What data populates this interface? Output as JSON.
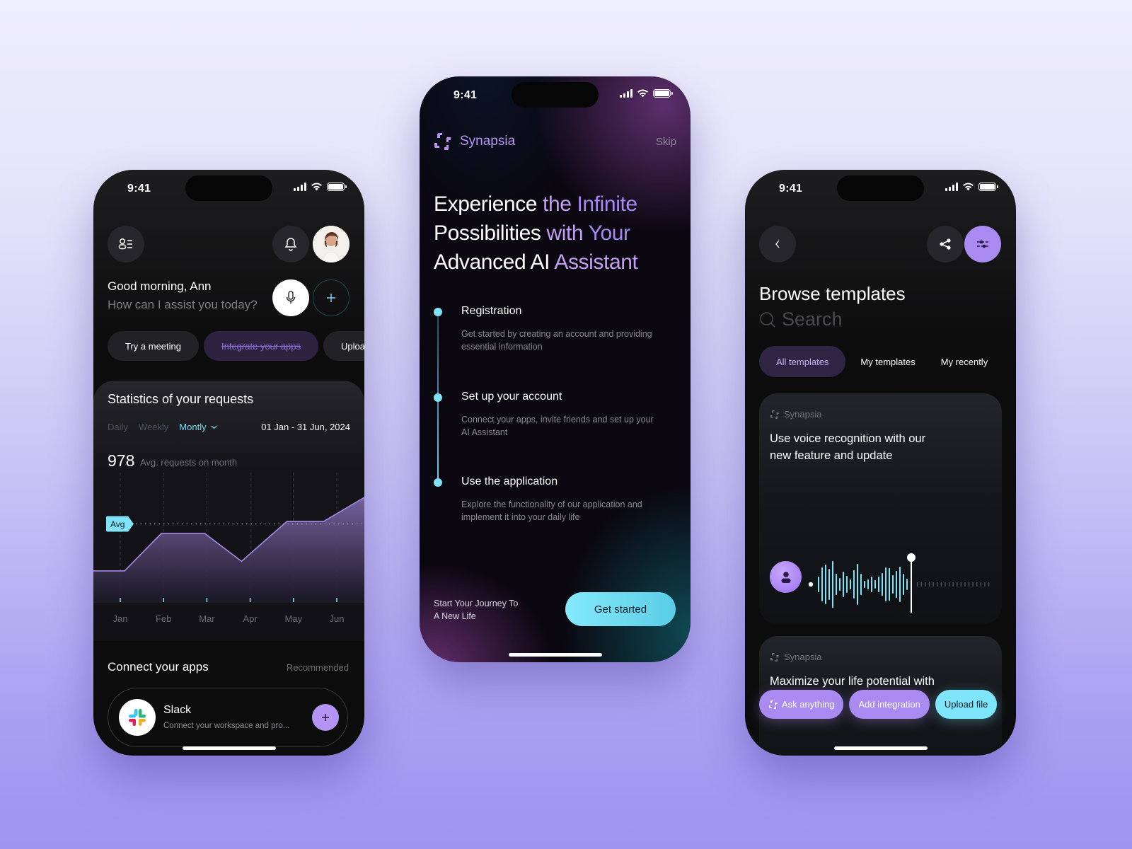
{
  "colors": {
    "accent_purple": "#a98af0",
    "accent_cyan": "#7fe2f6",
    "chart_line": "#a58ae6",
    "background_top": "#efeefc",
    "background_bottom": "#9f94f0"
  },
  "status_bar": {
    "time": "9:41"
  },
  "home": {
    "menu_icon": "profile-list-icon",
    "notification_icon": "bell-icon",
    "avatar_alt": "Ann profile photo",
    "greeting": "Good morning, Ann",
    "prompt": "How can I assist you today?",
    "mic_icon": "microphone-icon",
    "add_icon": "plus-icon",
    "chips": [
      "Try a meeting",
      "Integrate your apps",
      "Upload"
    ],
    "stats": {
      "title": "Statistics of your requests",
      "periods": [
        "Daily",
        "Weekly",
        "Montly"
      ],
      "active_period": "Montly",
      "date_range": "01 Jan - 31 Jun, 2024",
      "avg_value": "978",
      "avg_label": "Avg. requests on month",
      "avg_tag": "Avg"
    },
    "connect": {
      "title": "Connect your apps",
      "recommended": "Recommended",
      "app_name": "Slack",
      "app_desc": "Connect your workspace and pro..."
    }
  },
  "chart_data": {
    "type": "area",
    "title": "Statistics of your requests",
    "categories": [
      "Jan",
      "Feb",
      "Mar",
      "Apr",
      "May",
      "Jun"
    ],
    "series": [
      {
        "name": "Requests",
        "x": [
          -0.85,
          0.1,
          0.95,
          1.95,
          2.8,
          3.85,
          4.7,
          5.7,
          6.3
        ],
        "values": [
          390,
          390,
          860,
          860,
          510,
          1010,
          1010,
          1330,
          1330
        ]
      }
    ],
    "average": 978,
    "ylim": [
      0,
      1620
    ],
    "xlabel": "",
    "ylabel": "",
    "grid": "vertical dashed",
    "annotation": "Avg"
  },
  "onboarding": {
    "brand": "Synapsia",
    "skip": "Skip",
    "headline": [
      {
        "text": "Experience ",
        "tone": "w"
      },
      {
        "text": "the ",
        "tone": "pl"
      },
      {
        "text": "Infinite",
        "tone": "p"
      },
      {
        "text": " Possibilities ",
        "tone": "w"
      },
      {
        "text": "with ",
        "tone": "pl"
      },
      {
        "text": "Your",
        "tone": "p"
      },
      {
        "text": " Advanced AI ",
        "tone": "w"
      },
      {
        "text": "Assistant",
        "tone": "pl"
      }
    ],
    "steps": [
      {
        "title": "Registration",
        "desc": "Get started by creating an account and providing essential information"
      },
      {
        "title": "Set up your account",
        "desc": "Connect your apps, invite friends and set up your AI Assistant"
      },
      {
        "title": "Use the application",
        "desc": "Explore the functionality of our application and implement it into your daily life"
      }
    ],
    "journey": "Start Your Journey To A New Life",
    "cta": "Get started"
  },
  "templates": {
    "back_icon": "chevron-left-icon",
    "share_icon": "share-icon",
    "filter_icon": "sliders-icon",
    "title": "Browse templates",
    "search_placeholder": "Search",
    "tabs": [
      "All templates",
      "My templates",
      "My recently"
    ],
    "active_tab": "All templates",
    "cards": [
      {
        "brand": "Synapsia",
        "text": "Use voice recognition with our new feature and update"
      },
      {
        "brand": "Synapsia",
        "text": "Maximize your life potential with"
      }
    ],
    "waveform": {
      "played_fraction": 0.45,
      "played_bars": [
        22,
        48,
        56,
        44,
        66,
        30,
        18,
        36,
        24,
        14,
        40,
        58,
        30,
        10,
        14,
        22,
        12,
        22,
        32,
        48,
        46,
        26,
        38,
        50,
        30,
        16
      ]
    },
    "actions": [
      "Ask anything",
      "Add integration",
      "Upload file"
    ]
  }
}
